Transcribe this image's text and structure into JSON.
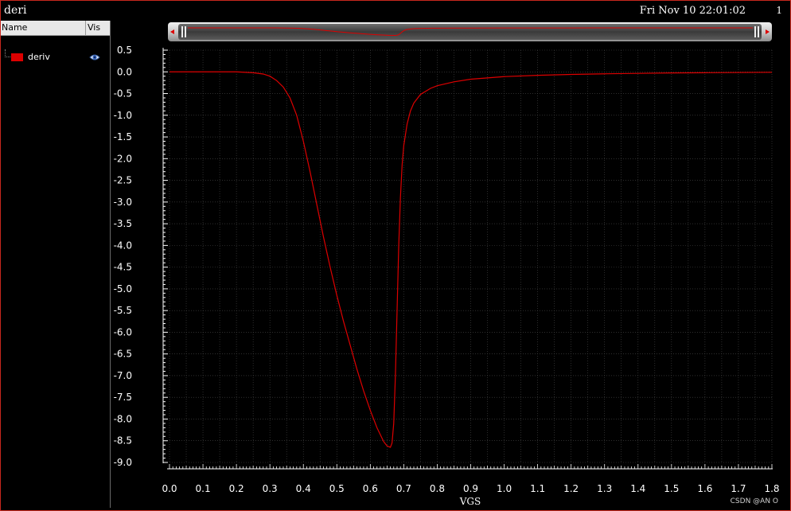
{
  "window": {
    "title": "deri",
    "datetime": "Fri Nov 10 22:01:02",
    "page": "1"
  },
  "legend": {
    "col_name": "Name",
    "col_vis": "Vis",
    "items": [
      {
        "label": "deriv",
        "color": "#dd0000",
        "icon": "eye-icon"
      }
    ]
  },
  "watermark": "CSDN @AN O",
  "chart_data": {
    "type": "line",
    "xlabel": "VGS",
    "ylabel": "",
    "xlim": [
      0.0,
      1.8
    ],
    "ylim": [
      -9.0,
      0.5
    ],
    "xticks": [
      "0.0",
      "0.1",
      "0.2",
      "0.3",
      "0.4",
      "0.5",
      "0.6",
      "0.7",
      "0.8",
      "0.9",
      "1.0",
      "1.1",
      "1.2",
      "1.3",
      "1.4",
      "1.5",
      "1.6",
      "1.7",
      "1.8"
    ],
    "yticks": [
      "0.5",
      "0.0",
      "-0.5",
      "-1.0",
      "-1.5",
      "-2.0",
      "-2.5",
      "-3.0",
      "-3.5",
      "-4.0",
      "-4.5",
      "-5.0",
      "-5.5",
      "-6.0",
      "-6.5",
      "-7.0",
      "-7.5",
      "-8.0",
      "-8.5",
      "-9.0"
    ],
    "grid": true,
    "series": [
      {
        "name": "deriv",
        "color": "#dd0000",
        "x": [
          0.0,
          0.1,
          0.2,
          0.25,
          0.28,
          0.3,
          0.32,
          0.34,
          0.36,
          0.38,
          0.4,
          0.42,
          0.44,
          0.46,
          0.48,
          0.5,
          0.52,
          0.54,
          0.56,
          0.58,
          0.6,
          0.62,
          0.64,
          0.65,
          0.66,
          0.665,
          0.67,
          0.675,
          0.68,
          0.685,
          0.69,
          0.695,
          0.7,
          0.71,
          0.72,
          0.73,
          0.75,
          0.78,
          0.8,
          0.85,
          0.9,
          1.0,
          1.1,
          1.2,
          1.3,
          1.4,
          1.5,
          1.6,
          1.7,
          1.8
        ],
        "y": [
          0.0,
          0.0,
          0.0,
          -0.02,
          -0.05,
          -0.1,
          -0.2,
          -0.35,
          -0.6,
          -1.0,
          -1.6,
          -2.3,
          -3.05,
          -3.8,
          -4.5,
          -5.15,
          -5.75,
          -6.3,
          -6.85,
          -7.35,
          -7.8,
          -8.2,
          -8.52,
          -8.62,
          -8.65,
          -8.55,
          -8.1,
          -7.0,
          -5.5,
          -4.0,
          -2.9,
          -2.15,
          -1.7,
          -1.2,
          -0.9,
          -0.72,
          -0.52,
          -0.38,
          -0.32,
          -0.23,
          -0.17,
          -0.11,
          -0.08,
          -0.06,
          -0.045,
          -0.035,
          -0.025,
          -0.02,
          -0.015,
          -0.01
        ]
      }
    ]
  }
}
